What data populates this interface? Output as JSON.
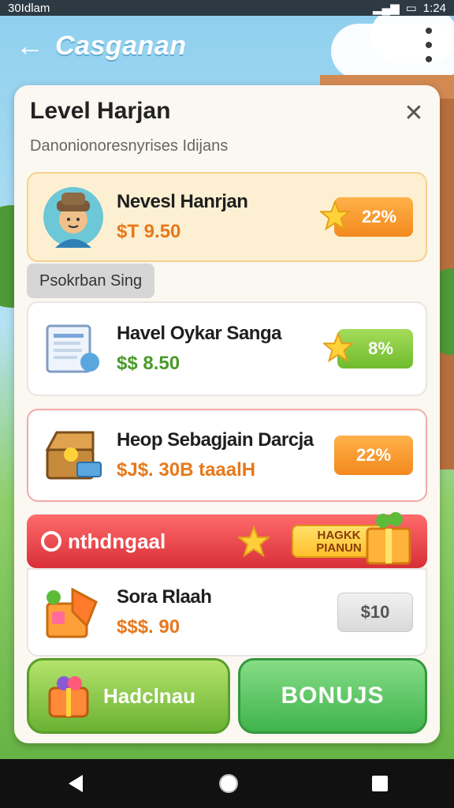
{
  "status": {
    "left_text": "30Idlam",
    "time": "1:24"
  },
  "appbar": {
    "title": "Casganan"
  },
  "panel": {
    "title": "Level Harjan",
    "subtitle": "Danonionoresnyrises Idijans",
    "section_label": "Psokrban Sing",
    "items": [
      {
        "name": "Nevesl Hanrjan",
        "price": "$T 9.50",
        "badge": "22%"
      },
      {
        "name": "Havel Oykar Sanga",
        "price": "$$ 8.50",
        "badge": "8%"
      },
      {
        "name": "Heop Sebagjain Darcja",
        "price": "$J$. 30B taaalH",
        "badge": "22%"
      },
      {
        "name": "Sora Rlaah",
        "price": "$$$. 90",
        "badge": "$10"
      }
    ],
    "promo": {
      "text": "nthdngaal",
      "tag_line1": "HAGKK",
      "tag_line2": "PIANUN"
    },
    "buttons": {
      "left_label": "Hadclnau",
      "right_label": "BONUJS"
    }
  },
  "colors": {
    "accent_orange": "#f3891d",
    "accent_green": "#6fbb2d",
    "promo_red": "#d82f38"
  },
  "icons": [
    "back-arrow-icon",
    "more-vert-icon",
    "close-icon",
    "star-icon",
    "gift-icon",
    "nav-back-icon",
    "nav-home-icon",
    "nav-recent-icon"
  ]
}
